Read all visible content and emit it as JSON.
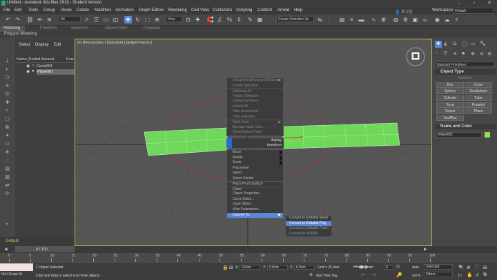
{
  "window": {
    "title": "Untitled - Autodesk 3ds Max 2018 - Student Version"
  },
  "menus": [
    "File",
    "Edit",
    "Tools",
    "Group",
    "Views",
    "Create",
    "Modifiers",
    "Animation",
    "Graph Editors",
    "Rendering",
    "Civil View",
    "Customize",
    "Scripting",
    "Content",
    "Arnold",
    "Help"
  ],
  "signin": "로그인",
  "workspaces": {
    "label": "Workspaces:",
    "value": "Default"
  },
  "toolbar": {
    "filter": "All",
    "view": "View",
    "selection_set": "Create Selection Se"
  },
  "ribbon": {
    "tabs": [
      "Modeling",
      "Freeform",
      "Selection",
      "Object Paint",
      "Populate"
    ],
    "sub": "Polygon Modeling"
  },
  "scene_explorer": {
    "tabs": [
      "Select",
      "Display",
      "Edit"
    ],
    "header_name": "Name (Sorted Ascend...",
    "header_frozen": "Froz",
    "items": [
      "Circle001",
      "Plane001"
    ]
  },
  "viewport": {
    "label": "[+] [Perspective ] [Standard ] [Edged Faces ]"
  },
  "quad_labels": [
    "display",
    "transform"
  ],
  "context_menu": [
    {
      "label": "Viewport Lighting and Shadows",
      "dim": true,
      "arrow": true
    },
    {
      "label": "Isolate Selection",
      "dim": true
    },
    {
      "label": "Unfreeze All",
      "dim": true,
      "sep": true
    },
    {
      "label": "Freeze Selection",
      "dim": true
    },
    {
      "label": "Unhide by Name",
      "dim": true
    },
    {
      "label": "Unhide All",
      "dim": true
    },
    {
      "label": "Hide Unselected",
      "dim": true
    },
    {
      "label": "Hide Selection",
      "dim": true
    },
    {
      "label": "State Sets",
      "dim": true,
      "arrow": true,
      "sep": true
    },
    {
      "label": "Manage State Sets...",
      "dim": true
    },
    {
      "label": "Show Motion Paths",
      "dim": true
    }
  ],
  "context_menu_lower": [
    {
      "label": "Move",
      "blk": true
    },
    {
      "label": "Rotate",
      "blk": true
    },
    {
      "label": "Scale",
      "blk": true
    },
    {
      "label": "Placement"
    },
    {
      "label": "Select"
    },
    {
      "label": "Select Similar"
    },
    {
      "label": "Place Pivot Surface",
      "sep": true
    },
    {
      "label": "Clone",
      "sep": true
    },
    {
      "label": "Object Properties..."
    },
    {
      "label": "Curve Editor..."
    },
    {
      "label": "Dope Sheet..."
    },
    {
      "label": "Wire Parameters..."
    },
    {
      "label": "Convert To:",
      "arrow": true,
      "hl": true
    }
  ],
  "convert_submenu": [
    {
      "label": "Convert to Editable Mesh"
    },
    {
      "label": "Convert to Editable Poly",
      "hl": true
    },
    {
      "label": "Convert to Editable Patch",
      "dim": true
    },
    {
      "label": "Convert to NURBS",
      "dim": true
    }
  ],
  "command_panel": {
    "dropdown": "Standard Primitives",
    "object_type": "Object Type",
    "autogrid": "AutoGrid",
    "buttons": [
      "Box",
      "Cone",
      "Sphere",
      "GeoSphere",
      "Cylinder",
      "Tube",
      "Torus",
      "Pyramid",
      "Teapot",
      "Plane",
      "TextPlus"
    ],
    "name_color": "Name and Color",
    "name_value": "Plane001",
    "color": "#8ee05a"
  },
  "default_label": "Default",
  "timeline": {
    "counter": "0 / 100",
    "ticks": [
      "0",
      "5",
      "10",
      "15",
      "20",
      "25",
      "30",
      "35",
      "40",
      "45",
      "50",
      "55",
      "60",
      "65",
      "70",
      "75",
      "80",
      "85",
      "90",
      "95",
      "100"
    ]
  },
  "status": {
    "maxscript": "MAXScript Mi",
    "selected": "1 Object Selected",
    "prompt": "Click and drag to select and move objects",
    "x_label": "X:",
    "x": "0.0cm",
    "y_label": "Y:",
    "y": "0.0cm",
    "z_label": "Z:",
    "z": "0.0cm",
    "grid": "Grid = 25.4cm",
    "add_time_tag": "Add Time Tag",
    "auto": "Auto",
    "setk": "Set K.",
    "selected_dd": "Selected",
    "filters": "Filters...",
    "frame": "0"
  }
}
